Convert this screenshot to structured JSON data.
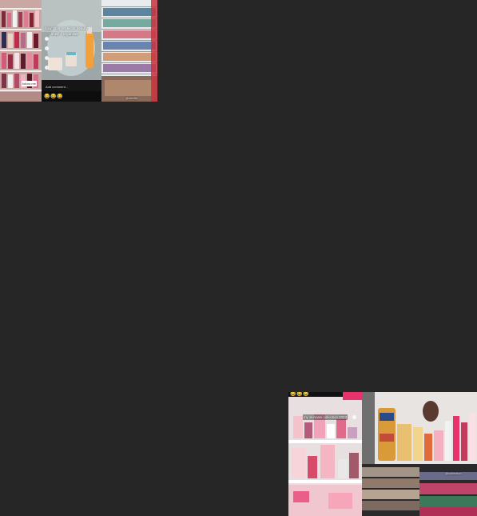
{
  "collage_top": {
    "panel_left": {
      "tag": "follow me"
    },
    "panel_center": {
      "caption_line1": "how i tidy my tiktok beauty",
      "caption_line2": "shelf + organiser",
      "comment_hint": "Add comment...",
      "emojis": [
        "😂",
        "😂",
        "😂"
      ]
    },
    "panel_right": {
      "tag": "@shelfie"
    }
  },
  "collage_bottom": {
    "panel_left": {
      "top_label": "",
      "caption": "my skincare collection 2023",
      "emojis": [
        "😂",
        "😂",
        "😂"
      ]
    },
    "panel_right": {
      "caption": "",
      "tag": "@collection"
    }
  },
  "colors": {
    "background": "#262626",
    "accent_pink": "#e8326b"
  }
}
